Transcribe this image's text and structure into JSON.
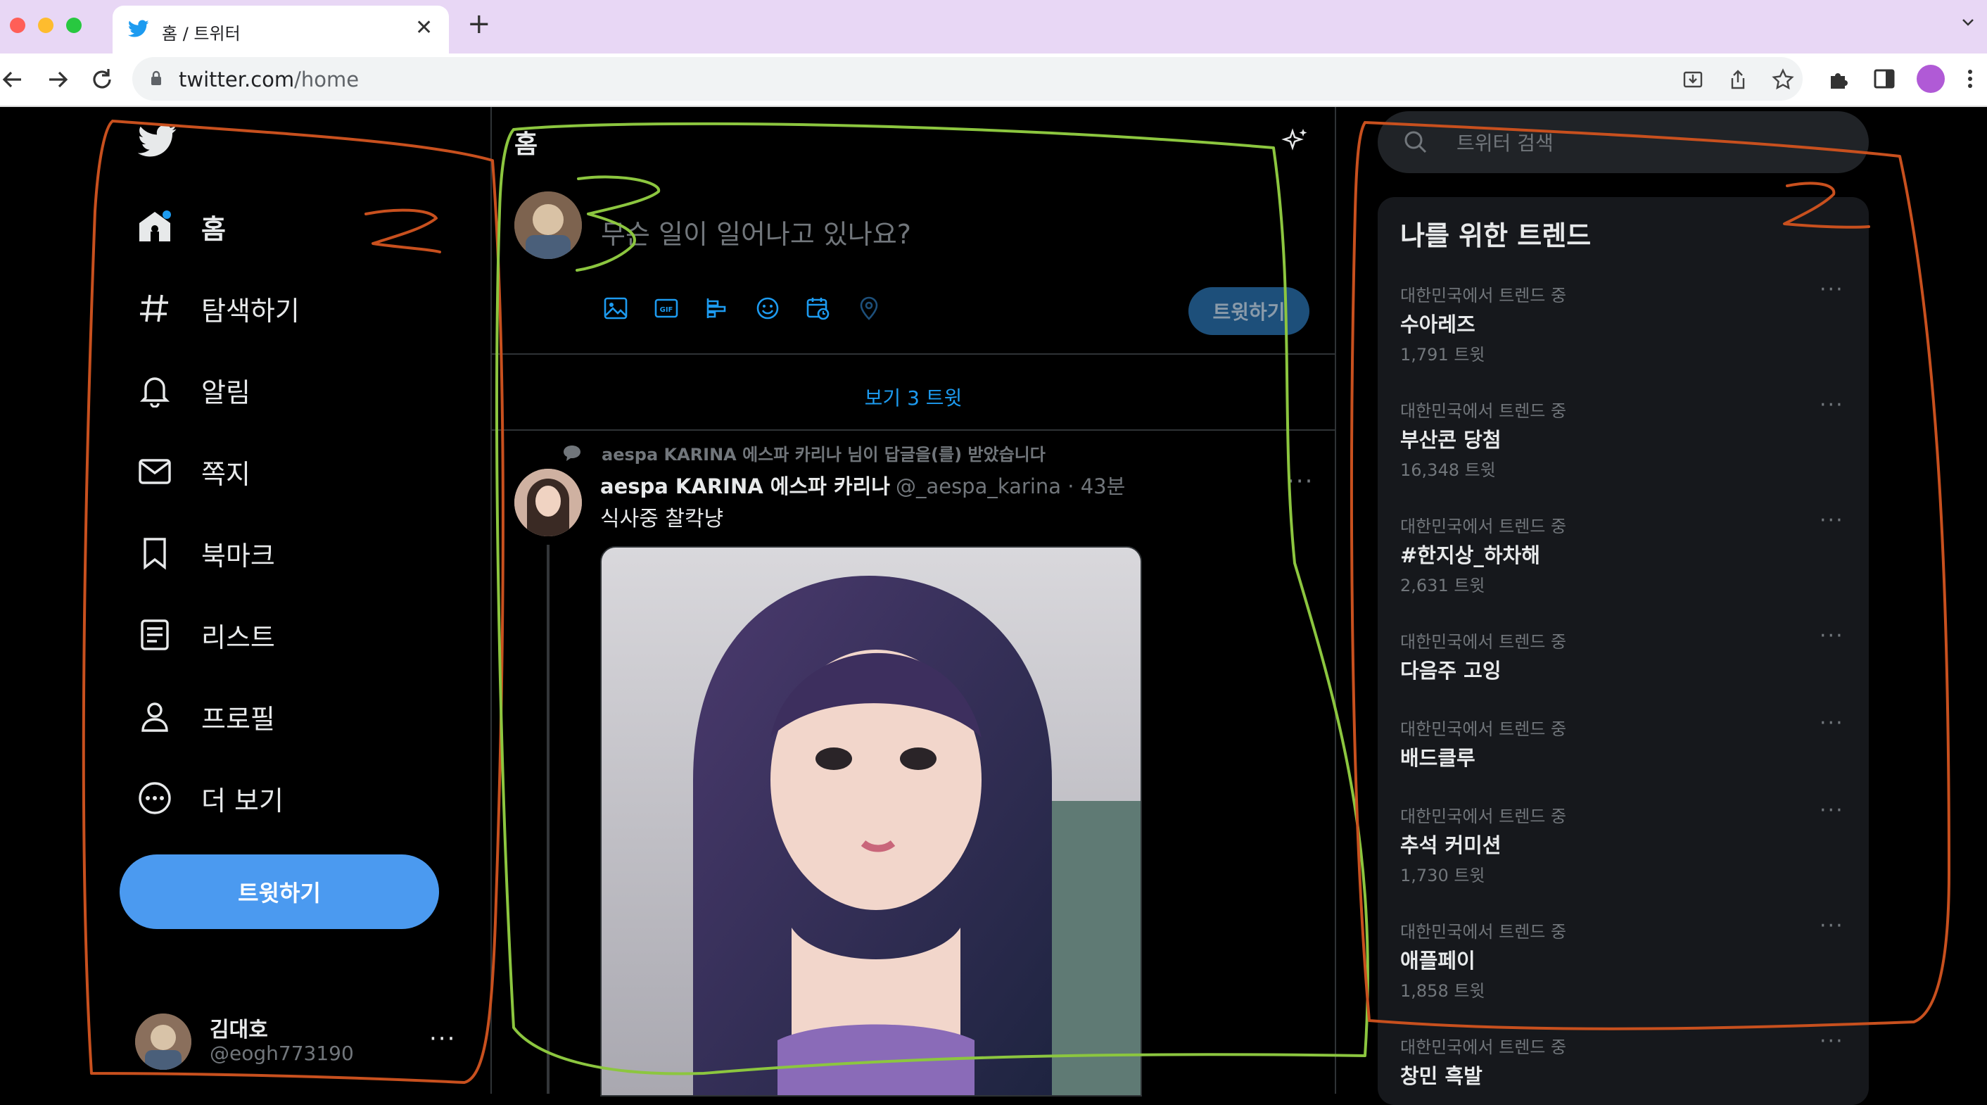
{
  "browser": {
    "tab_title": "홈 / 트위터",
    "url_host": "twitter.com",
    "url_path": "/home"
  },
  "nav": {
    "items": [
      {
        "label": "홈",
        "icon": "home-icon",
        "active": true
      },
      {
        "label": "탐색하기",
        "icon": "hashtag-icon"
      },
      {
        "label": "알림",
        "icon": "bell-icon"
      },
      {
        "label": "쪽지",
        "icon": "envelope-icon"
      },
      {
        "label": "북마크",
        "icon": "bookmark-icon"
      },
      {
        "label": "리스트",
        "icon": "list-icon"
      },
      {
        "label": "프로필",
        "icon": "person-icon"
      },
      {
        "label": "더 보기",
        "icon": "more-circle-icon"
      }
    ],
    "tweet_button": "트윗하기",
    "account": {
      "name": "김대호",
      "handle": "@eogh773190",
      "more": "···"
    }
  },
  "timeline": {
    "title": "홈",
    "composer_placeholder": "무슨 일이 일어나고 있나요?",
    "composer_tweet": "트윗하기",
    "show_new": "보기 3 트윗",
    "post": {
      "reply_context": "aespa KARINA 에스파 카리나 님이 답글을(를) 받았습니다",
      "author": "aespa KARINA 에스파 카리나",
      "meta": "@_aespa_karina · 43분",
      "text": "식사중 찰칵냥",
      "more": "···"
    }
  },
  "sidebar": {
    "search_placeholder": "트위터 검색",
    "trends_title": "나를 위한 트렌드",
    "trends": [
      {
        "context": "대한민국에서 트렌드 중",
        "name": "수아레즈",
        "count": "1,791 트윗"
      },
      {
        "context": "대한민국에서 트렌드 중",
        "name": "부산콘 당첨",
        "count": "16,348 트윗"
      },
      {
        "context": "대한민국에서 트렌드 중",
        "name": "#한지상_하차해",
        "count": "2,631 트윗"
      },
      {
        "context": "대한민국에서 트렌드 중",
        "name": "다음주 고잉",
        "count": ""
      },
      {
        "context": "대한민국에서 트렌드 중",
        "name": "배드클루",
        "count": ""
      },
      {
        "context": "대한민국에서 트렌드 중",
        "name": "추석 커미션",
        "count": "1,730 트윗"
      },
      {
        "context": "대한민국에서 트렌드 중",
        "name": "애플페이",
        "count": "1,858 트윗"
      },
      {
        "context": "대한민국에서 트렌드 중",
        "name": "창민 흑발",
        "count": ""
      }
    ]
  },
  "colors": {
    "accent": "#1d9bf0",
    "tweet_button": "#4b9af0",
    "annotation_orange": "#c8501e",
    "annotation_green": "#8cc63f"
  }
}
